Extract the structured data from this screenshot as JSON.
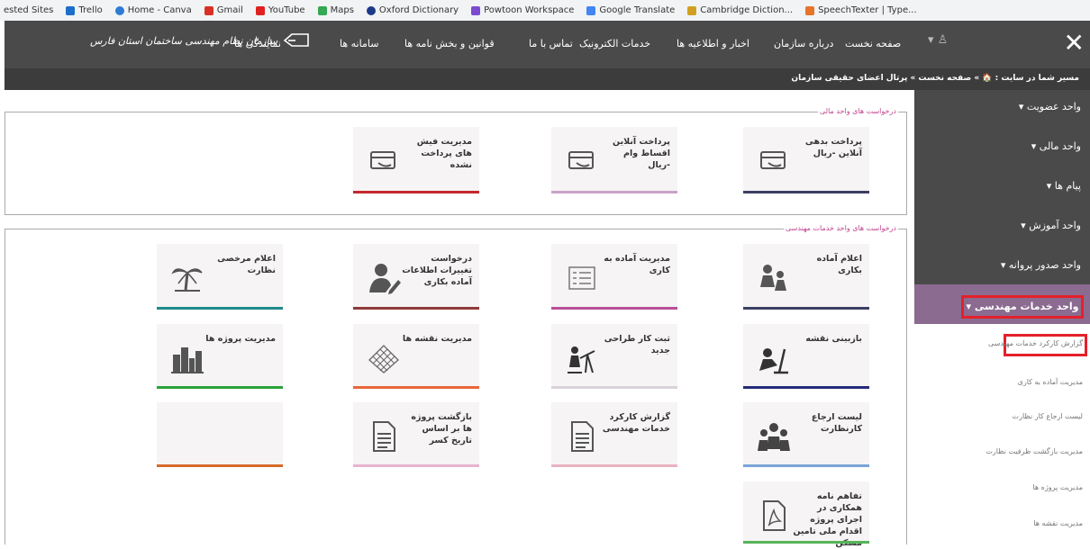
{
  "bookmarks": [
    {
      "label": "ested Sites"
    },
    {
      "label": "Trello",
      "color": "#1c6fc9"
    },
    {
      "label": "Home - Canva",
      "color": "#2e7bd6"
    },
    {
      "label": "Gmail",
      "color": "#d93025"
    },
    {
      "label": "YouTube",
      "color": "#e02020"
    },
    {
      "label": "Maps",
      "color": "#34a853"
    },
    {
      "label": "Oxford Dictionary",
      "color": "#1a3a8a"
    },
    {
      "label": "Powtoon Workspace",
      "color": "#7b4bd1"
    },
    {
      "label": "Google Translate",
      "color": "#4285f4"
    },
    {
      "label": "Cambridge Diction...",
      "color": "#d2a020"
    },
    {
      "label": "SpeechTexter | Type...",
      "color": "#e8732a"
    }
  ],
  "nav": {
    "links": [
      "صفحه نخست",
      "درباره سازمان",
      "اخبار و اطلاعیه ها",
      "خدمات الکترونیک",
      "تماس با ما",
      "قوانین و بخش نامه ها",
      "سامانه ها",
      "نمایندگی ها"
    ],
    "logo_text": "سازمان نظام مهندسی ساختمان استان فارس",
    "close_icon": "close-icon",
    "user_icon": "user-icon"
  },
  "breadcrumb": "مسیر شما در سایت : 🏠 » صفحه نخست » پرتال اعضای حقیقی سازمان",
  "sidebar": {
    "items": [
      "واحد عضویت ▾",
      "واحد مالی ▾",
      "پیام ها ▾",
      "واحد آموزش ▾",
      "واحد صدور پروانه ▾"
    ],
    "active": "واحد خدمات مهندسی ▾",
    "sub_items": [
      "گزارش کارکرد خدمات مهندسی",
      "مدیریت آماده به کاری",
      "لیست ارجاع کار نظارت",
      "مدیریت بازگشت ظرفیت نظارت",
      "مدیریت پروژه ها",
      "مدیریت نقشه ها"
    ]
  },
  "finance": {
    "legend": "درخواست های واحد مالی",
    "cards": [
      {
        "title": "پرداخت بدهی آنلاین -ریال",
        "icon": "card-payment-icon",
        "color": "#3b3f63"
      },
      {
        "title": "پرداخت آنلاین اقساط وام -ریال",
        "icon": "card-payment-icon",
        "color": "#c9a3c6"
      },
      {
        "title": "مدیریت فیش های پرداخت نشده",
        "icon": "card-payment-icon",
        "color": "#c4282d"
      }
    ]
  },
  "engineering": {
    "legend": "درخواست های واحد خدمات مهندسی",
    "cards": [
      {
        "title": "اعلام آماده بکاری",
        "icon": "workers-icon",
        "color": "#3c3f63"
      },
      {
        "title": "مدیریت آماده به کاری",
        "icon": "form-icon",
        "color": "#b94f98"
      },
      {
        "title": "درخواست تغییرات اطلاعات آماده بکاری",
        "icon": "user-edit-icon",
        "color": "#8e3a3a"
      },
      {
        "title": "اعلام مرخصی نظارت",
        "icon": "palm-tree-icon",
        "color": "#1f8a8a"
      },
      {
        "title": "بازبینی نقشه",
        "icon": "inspector-icon",
        "color": "#242a7a"
      },
      {
        "title": "ثبت کار طراحی جدید",
        "icon": "designer-icon",
        "color": "#d9d2da"
      },
      {
        "title": "مدیریت نقشه ها",
        "icon": "map-grid-icon",
        "color": "#e9663a"
      },
      {
        "title": "مدیریت پروژه ها",
        "icon": "buildings-icon",
        "color": "#2aa23a"
      },
      {
        "title": "لیست ارجاع کارنظارت",
        "icon": "group-icon",
        "color": "#7aa4d8"
      },
      {
        "title": "گزارش کارکرد خدمات مهندسی",
        "icon": "document-icon",
        "color": "#e9b2c2"
      },
      {
        "title": "بازگشت پروژه ها بر اساس تاریخ کسر",
        "icon": "document-icon",
        "color": "#e7b4cf"
      },
      {
        "title": "",
        "icon": "",
        "color": "#d86a2a"
      },
      {
        "title": "تفاهم نامه همکاری در اجرای پروژه اقدام ملی تامین مسکن",
        "icon": "pdf-icon",
        "color": "#57b35a"
      }
    ]
  }
}
